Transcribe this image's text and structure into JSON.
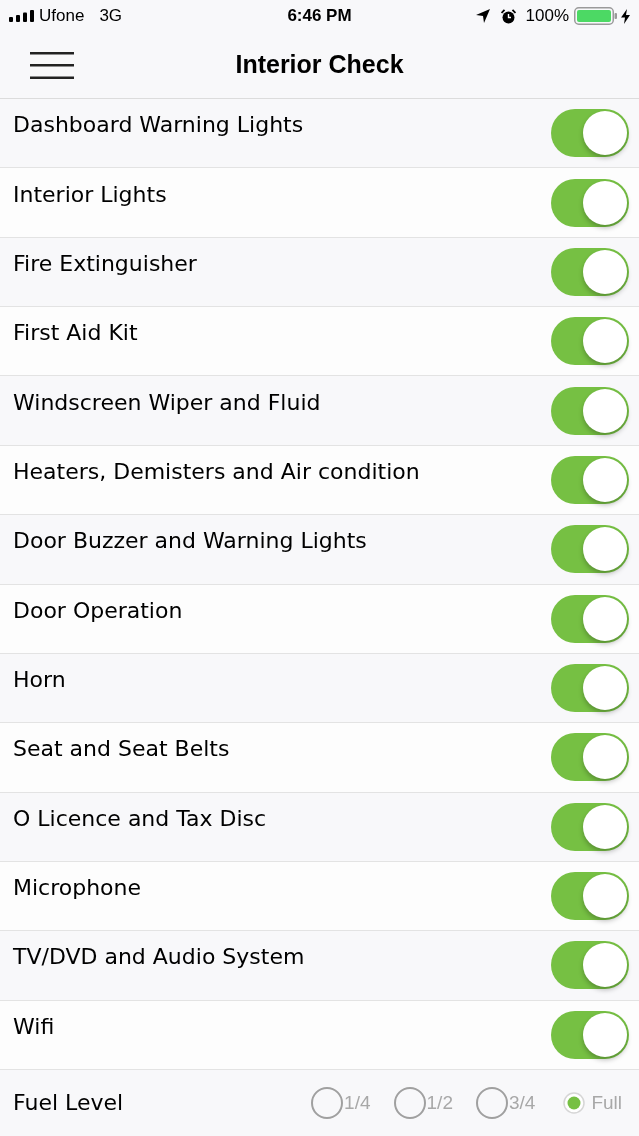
{
  "status_bar": {
    "carrier": "Ufone",
    "network": "3G",
    "time": "6:46 PM",
    "battery": "100%"
  },
  "header": {
    "title": "Interior Check"
  },
  "items": [
    {
      "label": "Dashboard Warning Lights",
      "on": true
    },
    {
      "label": "Interior Lights",
      "on": true
    },
    {
      "label": "Fire Extinguisher",
      "on": true
    },
    {
      "label": "First Aid Kit",
      "on": true
    },
    {
      "label": "Windscreen Wiper and Fluid",
      "on": true
    },
    {
      "label": "Heaters, Demisters and Air condition",
      "on": true
    },
    {
      "label": "Door Buzzer and Warning Lights",
      "on": true
    },
    {
      "label": "Door Operation",
      "on": true
    },
    {
      "label": "Horn",
      "on": true
    },
    {
      "label": "Seat and Seat Belts",
      "on": true
    },
    {
      "label": "O Licence and Tax Disc",
      "on": true
    },
    {
      "label": "Microphone",
      "on": true
    },
    {
      "label": "TV/DVD and Audio System",
      "on": true
    },
    {
      "label": "Wifi",
      "on": true
    }
  ],
  "fuel": {
    "label": "Fuel Level",
    "options": [
      {
        "label": "1/4",
        "selected": false
      },
      {
        "label": "1/2",
        "selected": false
      },
      {
        "label": "3/4",
        "selected": false
      },
      {
        "label": "Full",
        "selected": true
      }
    ]
  }
}
